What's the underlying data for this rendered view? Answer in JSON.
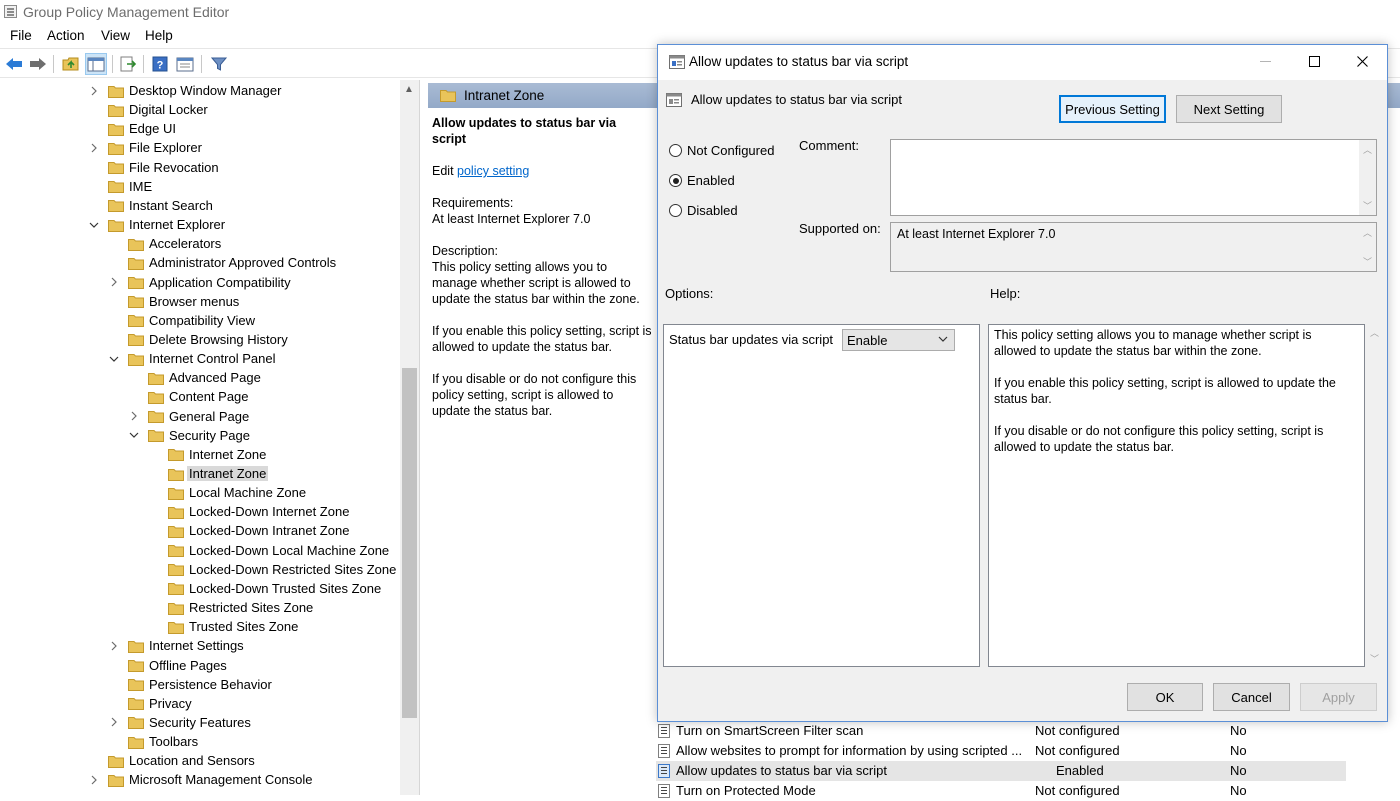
{
  "window": {
    "title": "Group Policy Management Editor"
  },
  "menu": [
    "File",
    "Action",
    "View",
    "Help"
  ],
  "toolbar": {
    "icons": [
      "back-arrow-icon",
      "forward-arrow-icon",
      "up-folder-icon",
      "show-hide-console-tree-icon",
      "export-list-icon",
      "help-icon",
      "properties-icon",
      "filter-icon"
    ]
  },
  "tree": {
    "items": [
      {
        "label": "Desktop Window Manager",
        "chev": ">"
      },
      {
        "label": "Digital Locker",
        "chev": ""
      },
      {
        "label": "Edge UI",
        "chev": ""
      },
      {
        "label": "File Explorer",
        "chev": ">"
      },
      {
        "label": "File Revocation",
        "chev": ""
      },
      {
        "label": "IME",
        "chev": ""
      },
      {
        "label": "Instant Search",
        "chev": ""
      },
      {
        "label": "Internet Explorer",
        "chev": "v"
      },
      {
        "label": "Accelerators",
        "chev": ""
      },
      {
        "label": "Administrator Approved Controls",
        "chev": ""
      },
      {
        "label": "Application Compatibility",
        "chev": ">"
      },
      {
        "label": "Browser menus",
        "chev": ""
      },
      {
        "label": "Compatibility View",
        "chev": ""
      },
      {
        "label": "Delete Browsing History",
        "chev": ""
      },
      {
        "label": "Internet Control Panel",
        "chev": "v"
      },
      {
        "label": "Advanced Page",
        "chev": ""
      },
      {
        "label": "Content Page",
        "chev": ""
      },
      {
        "label": "General Page",
        "chev": ">"
      },
      {
        "label": "Security Page",
        "chev": "v"
      },
      {
        "label": "Internet Zone",
        "chev": ""
      },
      {
        "label": "Intranet Zone",
        "chev": "",
        "selected": true
      },
      {
        "label": "Local Machine Zone",
        "chev": ""
      },
      {
        "label": "Locked-Down Internet Zone",
        "chev": ""
      },
      {
        "label": "Locked-Down Intranet Zone",
        "chev": ""
      },
      {
        "label": "Locked-Down Local Machine Zone",
        "chev": ""
      },
      {
        "label": "Locked-Down Restricted Sites Zone",
        "chev": ""
      },
      {
        "label": "Locked-Down Trusted Sites Zone",
        "chev": ""
      },
      {
        "label": "Restricted Sites Zone",
        "chev": ""
      },
      {
        "label": "Trusted Sites Zone",
        "chev": ""
      },
      {
        "label": "Internet Settings",
        "chev": ">"
      },
      {
        "label": "Offline Pages",
        "chev": ""
      },
      {
        "label": "Persistence Behavior",
        "chev": ""
      },
      {
        "label": "Privacy",
        "chev": ""
      },
      {
        "label": "Security Features",
        "chev": ">"
      },
      {
        "label": "Toolbars",
        "chev": ""
      },
      {
        "label": "Location and Sensors",
        "chev": ""
      },
      {
        "label": "Microsoft Management Console",
        "chev": ">"
      }
    ]
  },
  "middle": {
    "header": "Intranet Zone",
    "setting_title": "Allow updates to status bar via script",
    "edit_prefix": "Edit",
    "edit_link": "policy setting",
    "requirements_label": "Requirements:",
    "requirements_value": "At least Internet Explorer 7.0",
    "description_label": "Description:",
    "description_p1": "This policy setting allows you to manage whether script is allowed to update the status bar within the zone.",
    "description_p2": "If you enable this policy setting, script is allowed to update the status bar.",
    "description_p3": "If you disable or do not configure this policy setting, script is allowed to update the status bar."
  },
  "settings_list": [
    {
      "name": "Turn on SmartScreen Filter scan",
      "state": "Not configured",
      "comment": "No"
    },
    {
      "name": "Allow websites to prompt for information by using scripted ...",
      "state": "Not configured",
      "comment": "No"
    },
    {
      "name": "Allow updates to status bar via script",
      "state": "Enabled",
      "comment": "No",
      "highlight": true
    },
    {
      "name": "Turn on Protected Mode",
      "state": "Not configured",
      "comment": "No"
    }
  ],
  "dialog": {
    "title": "Allow updates to status bar via script",
    "setting_name": "Allow updates to status bar via script",
    "previous_button": "Previous Setting",
    "next_button": "Next Setting",
    "radio_not_configured": "Not Configured",
    "radio_enabled": "Enabled",
    "radio_disabled": "Disabled",
    "selected_state": "Enabled",
    "comment_label": "Comment:",
    "comment_value": "",
    "supported_label": "Supported on:",
    "supported_value": "At least Internet Explorer 7.0",
    "options_label": "Options:",
    "help_label": "Help:",
    "option_name": "Status bar updates via script",
    "option_value": "Enable",
    "help_p1": "This policy setting allows you to manage whether script is allowed to update the status bar within the zone.",
    "help_p2": "If you enable this policy setting, script is allowed to update the status bar.",
    "help_p3": "If you disable or do not configure this policy setting, script is allowed to update the status bar.",
    "ok_button": "OK",
    "cancel_button": "Cancel",
    "apply_button": "Apply"
  },
  "colors": {
    "header_band": "#a9bbd4",
    "folder": "#e9c45a",
    "link": "#0066cc",
    "dialog_border": "#5b8fd6",
    "default_button_border": "#0078d7"
  }
}
